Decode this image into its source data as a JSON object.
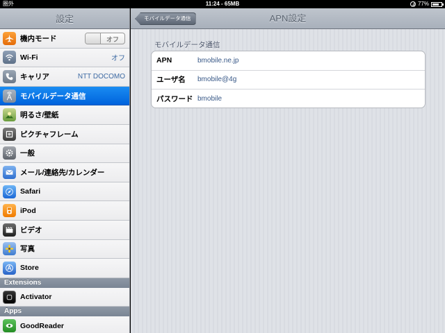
{
  "status": {
    "carrier": "圏外",
    "time": "11:24 - 65MB",
    "battery": "77%",
    "battery_level": 0.77
  },
  "sidebar": {
    "title": "設定",
    "items": [
      {
        "label": "機内モード",
        "toggle": "オフ",
        "icon": "airplane-icon"
      },
      {
        "label": "Wi-Fi",
        "value": "オフ",
        "icon": "wifi-icon"
      },
      {
        "label": "キャリア",
        "value": "NTT DOCOMO",
        "icon": "phone-icon"
      },
      {
        "label": "モバイルデータ通信",
        "icon": "cellular-icon",
        "selected": true
      },
      {
        "label": "明るさ/壁紙",
        "icon": "brightness-icon"
      },
      {
        "label": "ピクチャフレーム",
        "icon": "picture-frame-icon"
      },
      {
        "label": "一般",
        "icon": "gear-icon"
      },
      {
        "label": "メール/連絡先/カレンダー",
        "icon": "mail-icon"
      },
      {
        "label": "Safari",
        "icon": "safari-icon"
      },
      {
        "label": "iPod",
        "icon": "ipod-icon"
      },
      {
        "label": "ビデオ",
        "icon": "video-icon"
      },
      {
        "label": "写真",
        "icon": "photos-icon"
      },
      {
        "label": "Store",
        "icon": "store-icon"
      }
    ],
    "section_extensions": "Extensions",
    "extensions": [
      {
        "label": "Activator",
        "icon": "activator-icon"
      }
    ],
    "section_apps": "Apps",
    "apps": [
      {
        "label": "GoodReader",
        "icon": "goodreader-icon"
      }
    ]
  },
  "main": {
    "title": "APN設定",
    "back_label": "モバイルデータ通信",
    "group_title": "モバイルデータ通信",
    "fields": [
      {
        "label": "APN",
        "value": "bmobile.ne.jp"
      },
      {
        "label": "ユーザ名",
        "value": "bmobile@4g"
      },
      {
        "label": "パスワード",
        "value": "bmobile"
      }
    ]
  },
  "colors": {
    "selected": "#0a6fe6",
    "value_text": "#385887"
  }
}
